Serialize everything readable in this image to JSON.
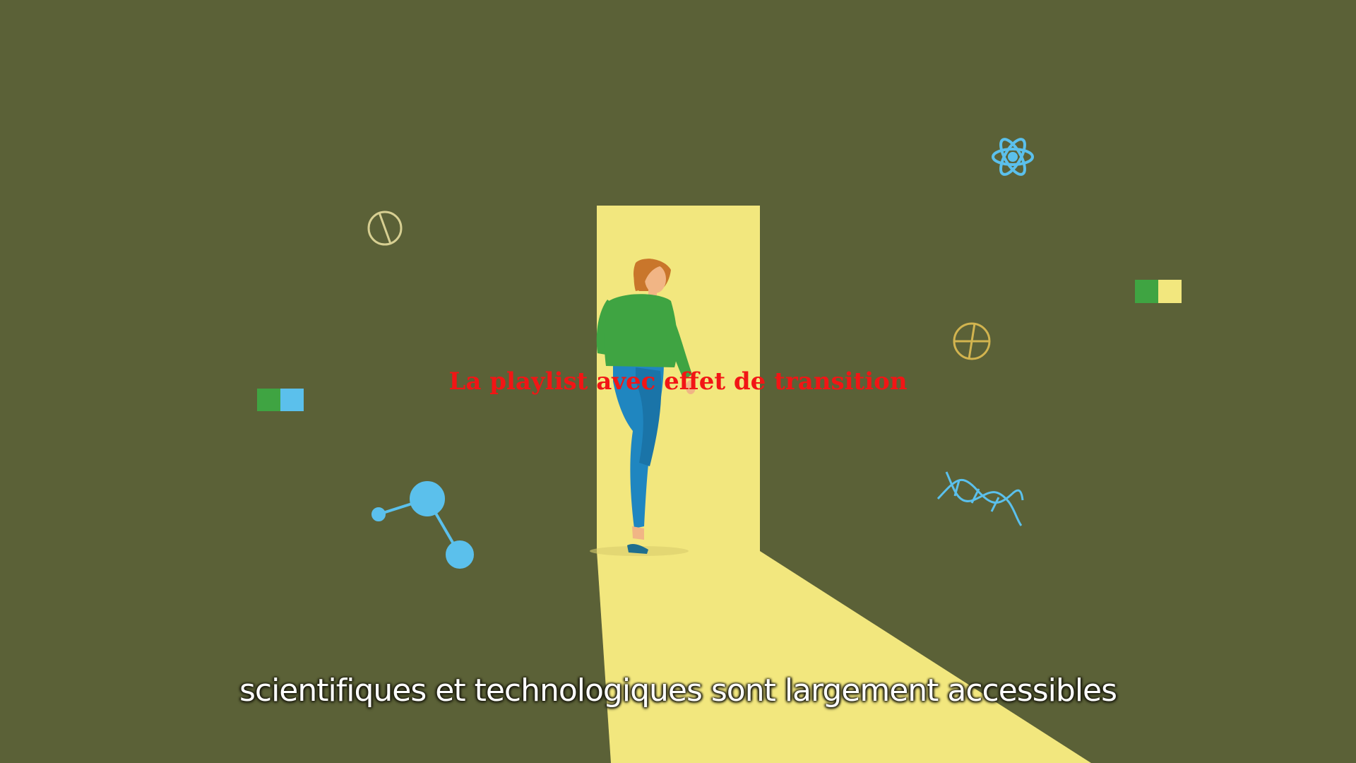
{
  "video": {
    "overlay_title": "La playlist avec effet de transition",
    "subtitle": "scientifiques et technologiques sont largement accessibles"
  },
  "colors": {
    "background": "#5b6137",
    "door_light": "#f2e77e",
    "sweater": "#3fa442",
    "jeans": "#1f86c0",
    "hair": "#c9762b",
    "skin": "#f1b585",
    "science_blue": "#5bc0ec",
    "overlay_title": "#f21515",
    "subtitle": "#ffffff"
  },
  "icons": [
    "atom-icon",
    "plus-circle-icon",
    "slash-circle-icon",
    "dna-icon",
    "molecule-icon",
    "green-blue-block-icon",
    "green-yellow-block-icon"
  ]
}
